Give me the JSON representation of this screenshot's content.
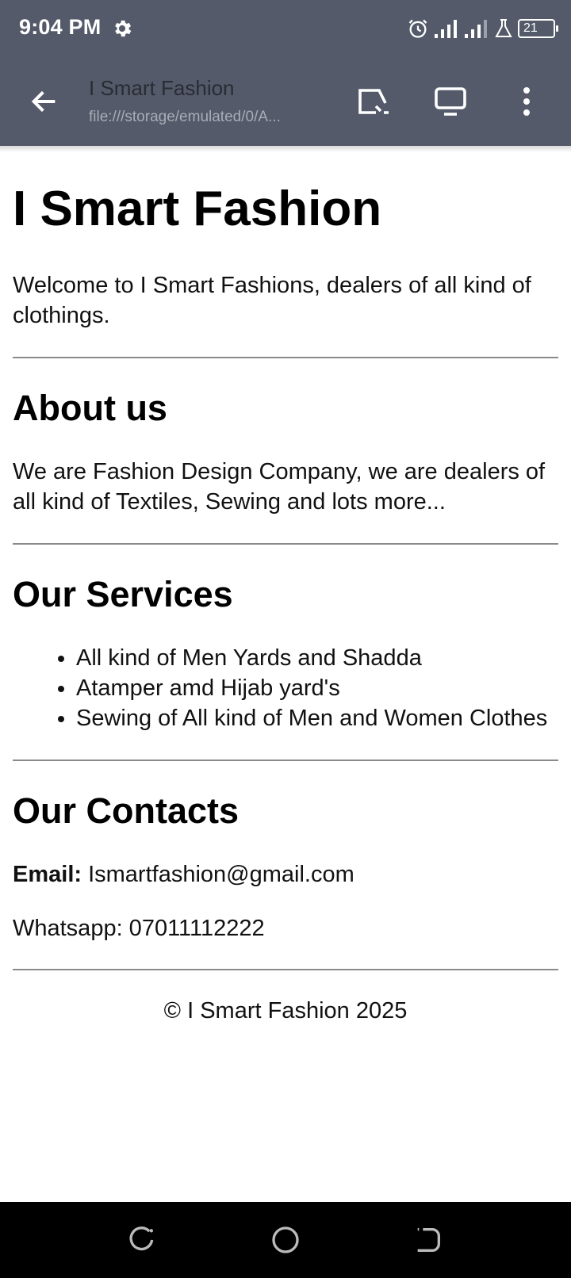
{
  "status_bar": {
    "time": "9:04 PM",
    "battery_level": "21",
    "icons": [
      "settings-gear-icon",
      "alarm-icon",
      "signal-icon",
      "signal-icon",
      "lab-icon",
      "battery-icon"
    ]
  },
  "toolbar": {
    "title": "I Smart Fashion",
    "url": "file:///storage/emulated/0/A...",
    "icons": [
      "back-arrow-icon",
      "open-in-browser-icon",
      "desktop-view-icon",
      "more-vert-icon"
    ]
  },
  "page": {
    "title": "I Smart Fashion",
    "welcome": "Welcome to I Smart Fashions, dealers of all kind of clothings.",
    "about": {
      "heading": "About us",
      "text": "We are Fashion Design Company, we are dealers of all kind of Textiles, Sewing and lots more..."
    },
    "services": {
      "heading": "Our Services",
      "items": [
        "All kind of Men Yards and Shadda",
        "Atamper amd Hijab yard's",
        "Sewing of All kind of Men and Women Clothes"
      ]
    },
    "contacts": {
      "heading": "Our Contacts",
      "email_label": "Email:",
      "email_value": "Ismartfashion@gmail.com",
      "whatsapp": "Whatsapp: 07011112222"
    },
    "footer": "© I Smart Fashion 2025"
  },
  "nav_bar": {
    "icons": [
      "recents-icon",
      "home-icon",
      "back-icon"
    ]
  },
  "colors": {
    "toolbar_bg": "#545a6a",
    "nav_bg": "#000000",
    "page_bg": "#ffffff"
  }
}
